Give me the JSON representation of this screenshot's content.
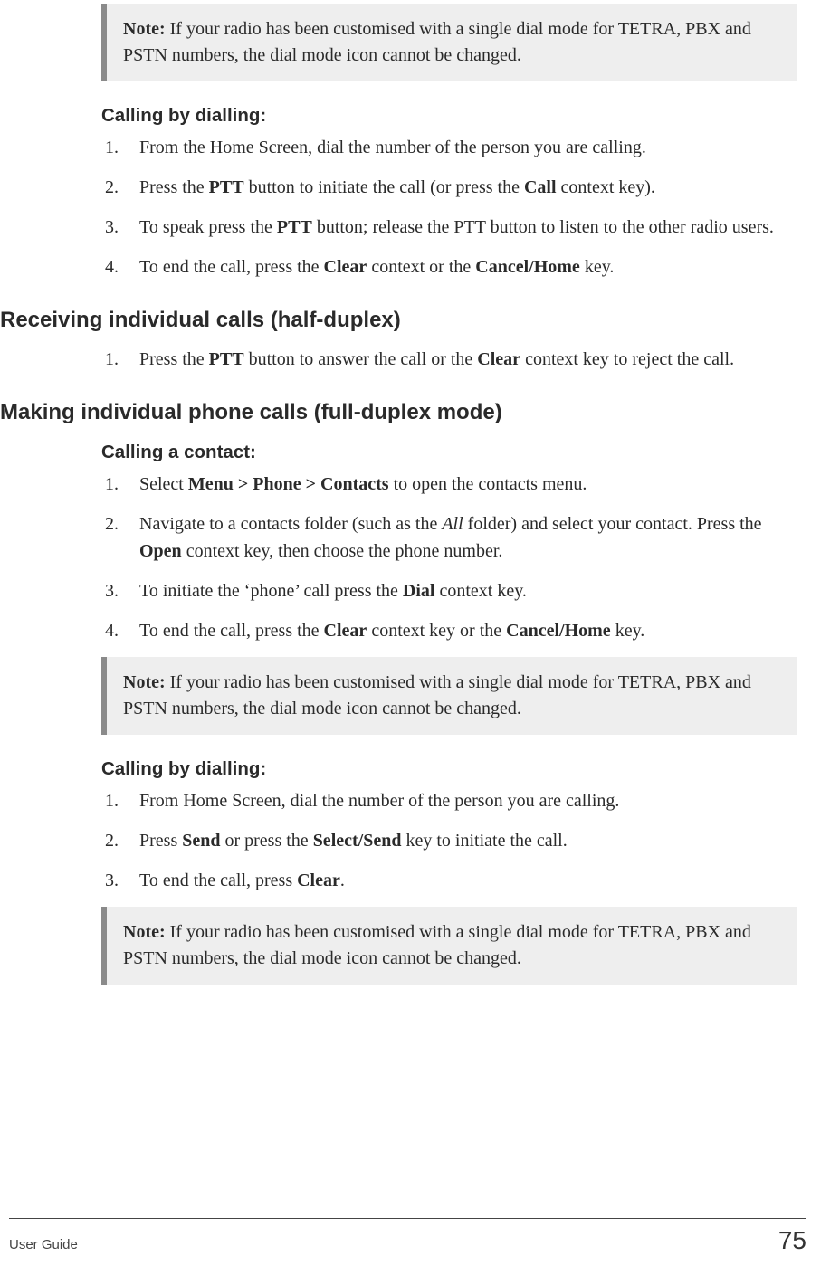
{
  "note1": {
    "label": "Note:",
    "text": " If your radio has been customised with a single dial mode for TETRA, PBX and PSTN numbers, the dial mode icon cannot be changed."
  },
  "sec_a": {
    "heading": "Calling by dialling:",
    "steps": [
      {
        "n": "1.",
        "parts": [
          {
            "t": "From the Home Screen, dial the number of the person you are calling."
          }
        ]
      },
      {
        "n": "2.",
        "parts": [
          {
            "t": "Press the "
          },
          {
            "t": "PTT",
            "b": true
          },
          {
            "t": " button to initiate the call (or press the "
          },
          {
            "t": "Call",
            "b": true
          },
          {
            "t": " context key)."
          }
        ]
      },
      {
        "n": "3.",
        "parts": [
          {
            "t": "To speak press the "
          },
          {
            "t": "PTT",
            "b": true
          },
          {
            "t": " button; release the PTT button to listen to the other radio users."
          }
        ]
      },
      {
        "n": "4.",
        "parts": [
          {
            "t": "To end the call, press the "
          },
          {
            "t": "Clear",
            "b": true
          },
          {
            "t": " context or the "
          },
          {
            "t": "Cancel/Home",
            "b": true
          },
          {
            "t": " key."
          }
        ]
      }
    ]
  },
  "h_recv": "Receiving individual calls (half-duplex)",
  "sec_recv": {
    "steps": [
      {
        "n": "1.",
        "parts": [
          {
            "t": "Press the "
          },
          {
            "t": "PTT",
            "b": true
          },
          {
            "t": " button to answer the call or the "
          },
          {
            "t": "Clear",
            "b": true
          },
          {
            "t": " context key to reject the call."
          }
        ]
      }
    ]
  },
  "h_make": "Making individual phone calls (full-duplex mode)",
  "sec_contact": {
    "heading": "Calling a contact:",
    "steps": [
      {
        "n": "1.",
        "parts": [
          {
            "t": "Select "
          },
          {
            "t": "Menu > Phone > Contacts",
            "b": true
          },
          {
            "t": " to open the contacts menu."
          }
        ]
      },
      {
        "n": "2.",
        "parts": [
          {
            "t": "Navigate to a contacts folder (such as the "
          },
          {
            "t": "All",
            "i": true
          },
          {
            "t": " folder) and select your contact. Press the "
          },
          {
            "t": "Open",
            "b": true
          },
          {
            "t": " context key, then choose the phone number."
          }
        ]
      },
      {
        "n": "3.",
        "parts": [
          {
            "t": " To initiate the ‘phone’ call press the "
          },
          {
            "t": "Dial",
            "b": true
          },
          {
            "t": " context key."
          }
        ]
      },
      {
        "n": "4.",
        "parts": [
          {
            "t": "To end the call, press the "
          },
          {
            "t": "Clear",
            "b": true
          },
          {
            "t": " context key or the "
          },
          {
            "t": "Cancel/Home",
            "b": true
          },
          {
            "t": " key."
          }
        ]
      }
    ]
  },
  "note2": {
    "label": "Note:",
    "text": " If your radio has been customised with a single dial mode for TETRA, PBX and PSTN numbers, the dial mode icon cannot be changed."
  },
  "sec_dial2": {
    "heading": "Calling by dialling:",
    "steps": [
      {
        "n": "1.",
        "parts": [
          {
            "t": "From Home Screen, dial the number of the person you are calling."
          }
        ]
      },
      {
        "n": "2.",
        "parts": [
          {
            "t": "Press "
          },
          {
            "t": "Send",
            "b": true
          },
          {
            "t": " or press the "
          },
          {
            "t": "Select/Send",
            "b": true
          },
          {
            "t": " key to initiate the call."
          }
        ]
      },
      {
        "n": "3.",
        "parts": [
          {
            "t": " To end the call, press "
          },
          {
            "t": "Clear",
            "b": true
          },
          {
            "t": "."
          }
        ]
      }
    ]
  },
  "note3": {
    "label": "Note:",
    "text": " If your radio has been customised with a single dial mode for TETRA, PBX and PSTN numbers, the dial mode icon cannot be changed."
  },
  "footer": {
    "left": "User Guide",
    "right": "75"
  }
}
